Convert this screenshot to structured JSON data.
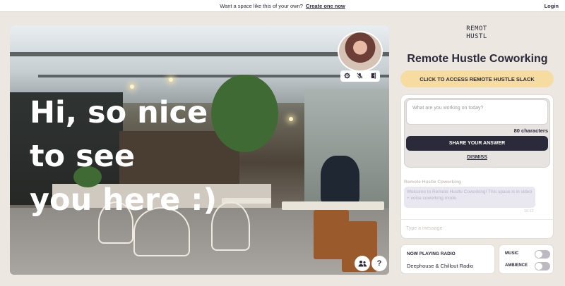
{
  "banner": {
    "text": "Want a space like this of your own?",
    "cta": "Create one now",
    "login": "Login"
  },
  "scene": {
    "greeting": "Hi, so nice\nto see\nyou here :)"
  },
  "video_tile": {
    "icons": [
      "gear-icon",
      "microphone-muted-icon",
      "exit-door-icon"
    ]
  },
  "corner_buttons": {
    "icons": [
      "people-icon",
      "help-icon"
    ],
    "help_glyph": "?"
  },
  "sidebar": {
    "logo_line1": "REMOT",
    "logo_line2": "HUSTL",
    "title": "Remote Hustle Coworking",
    "slack_button": "CLICK TO ACCESS REMOTE HUSTLE SLACK",
    "question": {
      "placeholder": "What are you working on today?",
      "char_count": "80 characters",
      "share_button": "SHARE YOUR ANSWER",
      "dismiss": "DISMISS"
    },
    "chat": {
      "sender": "Remote Hustle Coworking",
      "message": "Welcome to Remote Hustle Coworking! This space is in video + voice coworking mode.",
      "time": "10:12",
      "input_placeholder": "Type a message"
    },
    "radio": {
      "label": "NOW PLAYING RADIO",
      "station": "Deephouse & Chillout Radio"
    },
    "toggles": {
      "music": "MUSIC",
      "ambience": "AMBIENCE",
      "music_on": false,
      "ambience_on": false
    }
  },
  "colors": {
    "background": "#ece7e0",
    "accent_yellow": "#f6dca1",
    "dark": "#2b2a3a"
  }
}
